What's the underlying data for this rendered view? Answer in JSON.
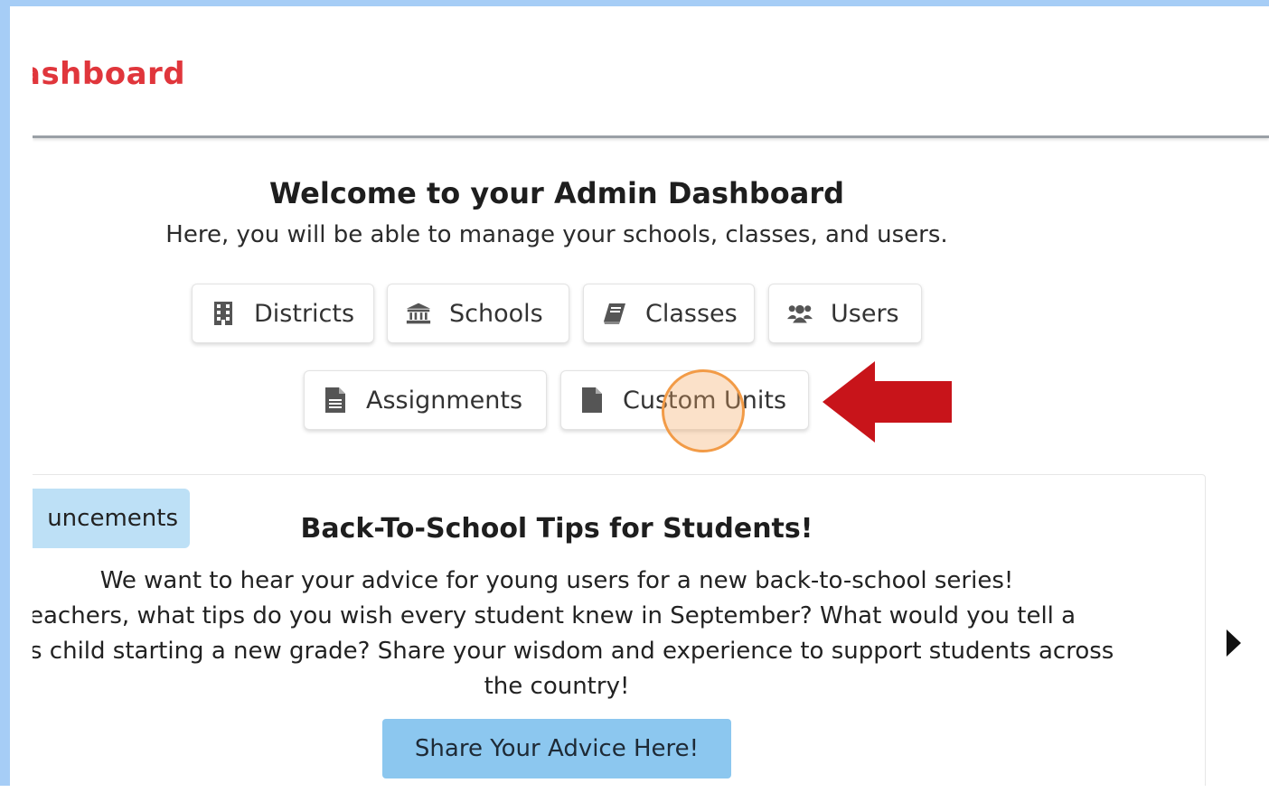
{
  "header": {
    "title_partial": "ashboard"
  },
  "welcome": {
    "title": "Welcome to your Admin Dashboard",
    "subtitle": "Here, you will be able to manage your schools, classes, and users."
  },
  "nav_buttons": [
    {
      "label": "Districts",
      "icon": "building-icon"
    },
    {
      "label": "Schools",
      "icon": "landmark-icon"
    },
    {
      "label": "Classes",
      "icon": "book-icon"
    },
    {
      "label": "Users",
      "icon": "users-icon"
    },
    {
      "label": "Assignments",
      "icon": "file-text-icon"
    },
    {
      "label": "Custom Units",
      "icon": "file-icon"
    }
  ],
  "announcements": {
    "tab_label_partial": "uncements",
    "title": "Back-To-School Tips for Students!",
    "body_lines": [
      "We want to hear your advice for young users for a new back-to-school series!",
      "eachers, what tips do you wish every student knew in September? What would you tell a",
      "s child starting a new grade? Share your wisdom and experience to support students across",
      "the country!"
    ],
    "cta_label": "Share Your Advice Here!",
    "next_icon": "caret-right-icon"
  },
  "colors": {
    "brand_red": "#e0363c",
    "frame_blue": "#a6cdf6",
    "tab_blue": "#bde0f6",
    "cta_blue": "#8cc7ef",
    "arrow_red": "#c8141a",
    "highlight_orange": "#f29b47"
  }
}
